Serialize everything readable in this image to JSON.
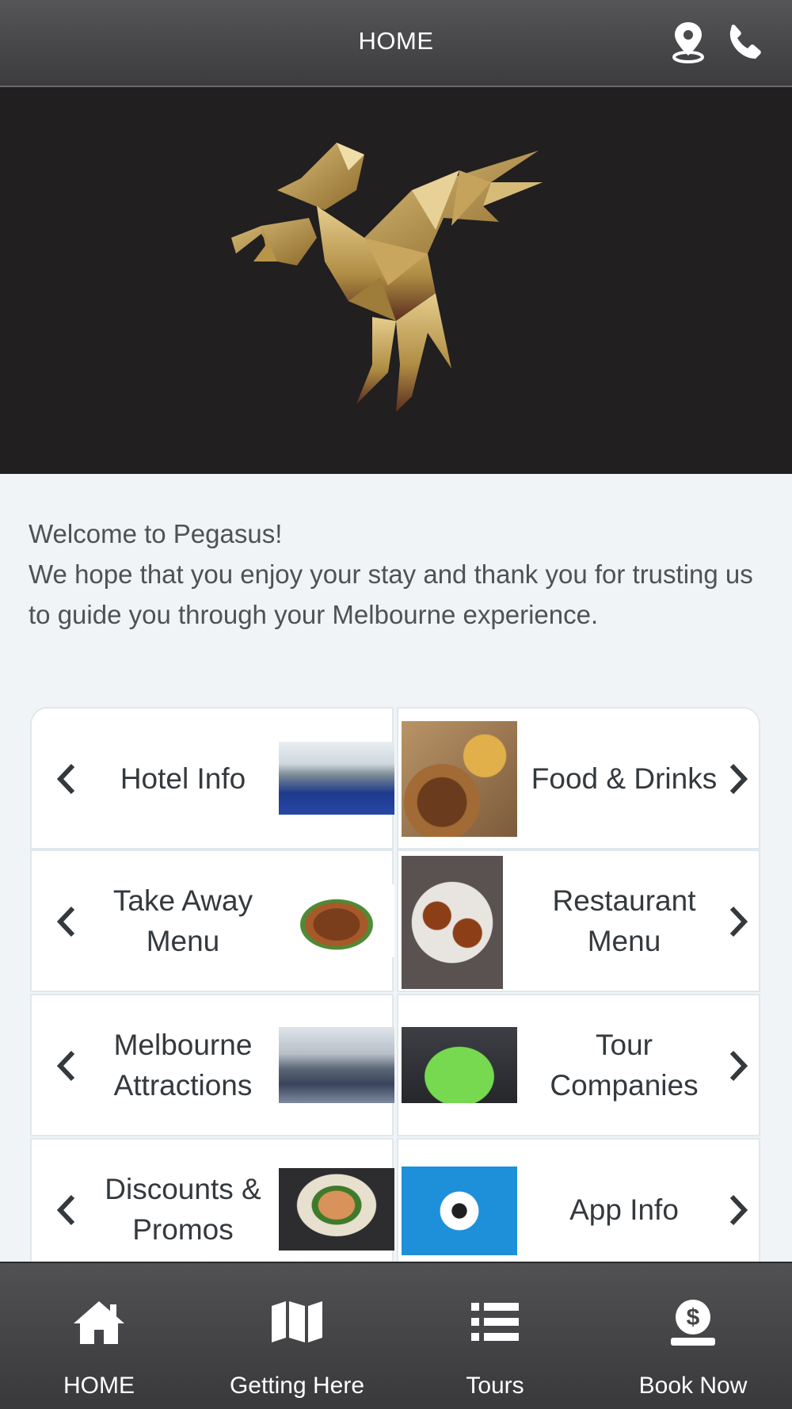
{
  "header": {
    "title": "HOME",
    "icons": [
      "location-pin-icon",
      "phone-icon"
    ]
  },
  "hero": {
    "logo": "pegasus-logo"
  },
  "welcome": {
    "line1": "Welcome to Pegasus!",
    "line2": "We hope that you enjoy your stay and thank you for trusting us to guide you through your Melbourne experience."
  },
  "tiles": {
    "hotel_info": "Hotel Info",
    "food_drinks": "Food & Drinks",
    "take_away_1": "Take Away",
    "take_away_2": "Menu",
    "restaurant_1": "Restaurant",
    "restaurant_2": "Menu",
    "melbourne_1": "Melbourne",
    "melbourne_2": "Attractions",
    "tour_1": "Tour",
    "tour_2": "Companies",
    "discounts_1": "Discounts &",
    "discounts_2": "Promos",
    "app_info": "App Info"
  },
  "bottom_nav": {
    "home": "HOME",
    "getting_here": "Getting Here",
    "tours": "Tours",
    "book_now": "Book Now"
  },
  "colors": {
    "header_bg": "#464648",
    "hero_bg": "#211f20",
    "page_bg": "#f1f4f6",
    "gold": "#c9a75f",
    "text": "#34393d"
  }
}
